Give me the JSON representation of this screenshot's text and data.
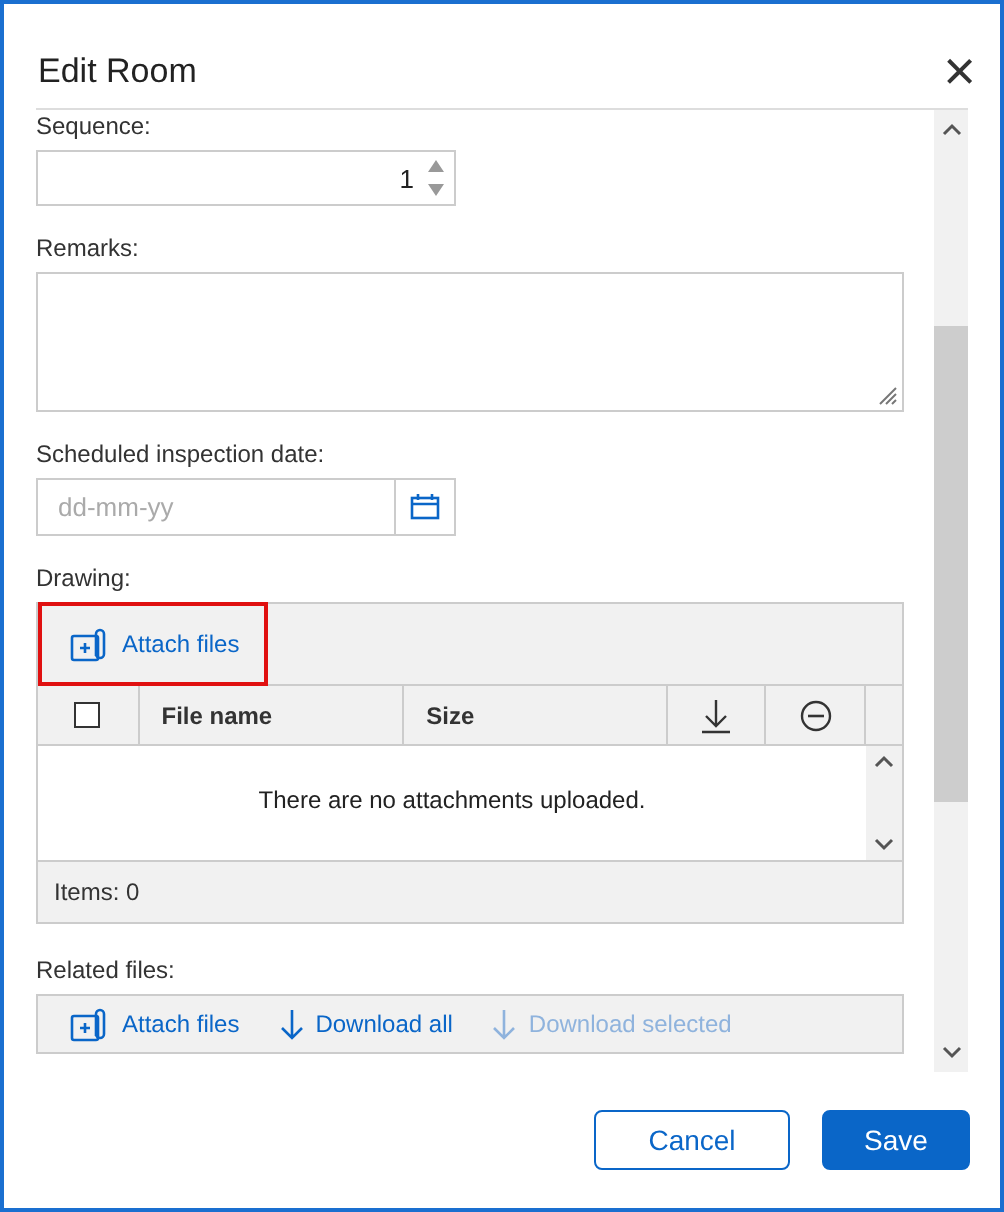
{
  "dialog": {
    "title": "Edit Room",
    "close_label": "×"
  },
  "sequence": {
    "label": "Sequence:",
    "value": "1"
  },
  "remarks": {
    "label": "Remarks:"
  },
  "inspection_date": {
    "label": "Scheduled inspection date:",
    "placeholder": "dd-mm-yy"
  },
  "drawing": {
    "label": "Drawing:",
    "toolbar": [
      {
        "kind": "attach",
        "label": "Attach files",
        "disabled": false,
        "highlighted": true
      }
    ],
    "columns": [
      {
        "kind": "checkbox",
        "checked": false
      },
      {
        "kind": "text",
        "label": "File name"
      },
      {
        "kind": "text",
        "label": "Size"
      },
      {
        "kind": "download"
      },
      {
        "kind": "remove"
      }
    ],
    "empty_message": "There are no attachments uploaded.",
    "footer": "Items: 0"
  },
  "related_files": {
    "label": "Related files:",
    "toolbar": [
      {
        "kind": "attach",
        "label": "Attach files",
        "disabled": false,
        "highlighted": false
      },
      {
        "kind": "download",
        "label": "Download all",
        "disabled": false,
        "highlighted": false
      },
      {
        "kind": "download",
        "label": "Download selected",
        "disabled": true,
        "highlighted": false
      }
    ]
  },
  "buttons": [
    {
      "kind": "secondary",
      "label": "Cancel"
    },
    {
      "kind": "primary",
      "label": "Save"
    }
  ]
}
